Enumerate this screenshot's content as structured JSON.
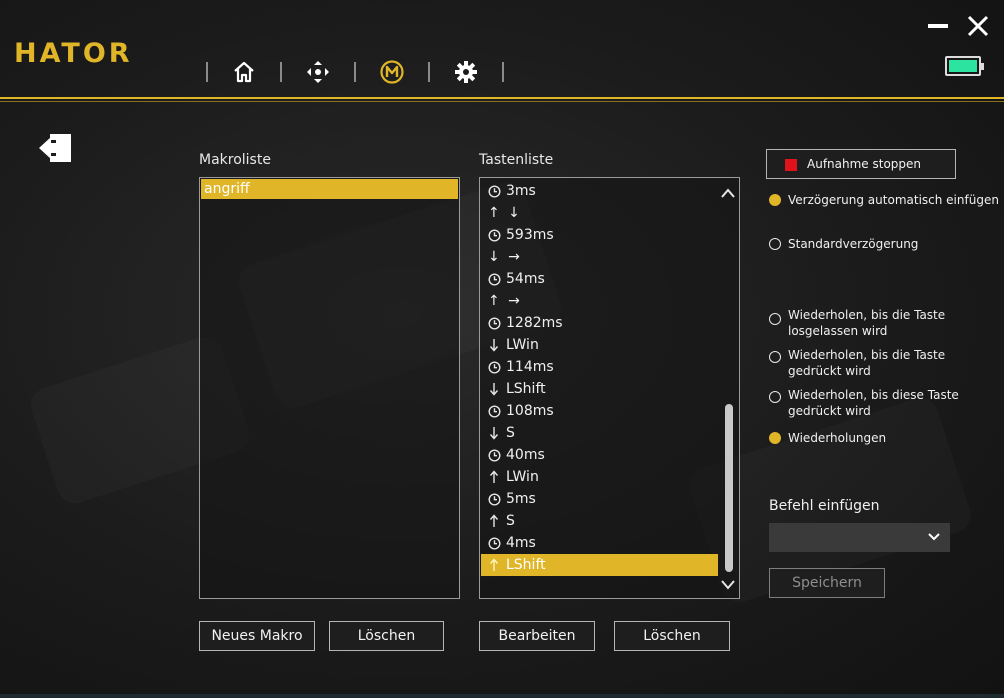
{
  "app": {
    "logo": "HATOR"
  },
  "nav": [
    {
      "name": "home-icon"
    },
    {
      "name": "dpad-icon"
    },
    {
      "name": "macro-m-icon"
    },
    {
      "name": "gear-icon"
    }
  ],
  "colors": {
    "accent": "#e0b528",
    "battery": "#2de3a0",
    "record_stop": "#e0121b"
  },
  "macro_list": {
    "label": "Makroliste",
    "items": [
      "angriff"
    ],
    "selected_index": 0,
    "new_button": "Neues Makro",
    "delete_button": "Löschen"
  },
  "key_list": {
    "label": "Tastenliste",
    "rows": [
      {
        "icon": "clock-icon",
        "text": "3ms"
      },
      {
        "icon": "arrows-icon",
        "text": "↑ ↓"
      },
      {
        "icon": "clock-icon",
        "text": "593ms"
      },
      {
        "icon": "arrows-icon",
        "text": "↓ →"
      },
      {
        "icon": "clock-icon",
        "text": "54ms"
      },
      {
        "icon": "arrows-icon",
        "text": "↑ →"
      },
      {
        "icon": "clock-icon",
        "text": "1282ms"
      },
      {
        "icon": "arrow-down-icon",
        "text": "LWin"
      },
      {
        "icon": "clock-icon",
        "text": "114ms"
      },
      {
        "icon": "arrow-down-icon",
        "text": "LShift"
      },
      {
        "icon": "clock-icon",
        "text": "108ms"
      },
      {
        "icon": "arrow-down-icon",
        "text": "S"
      },
      {
        "icon": "clock-icon",
        "text": "40ms"
      },
      {
        "icon": "arrow-up-icon",
        "text": "LWin"
      },
      {
        "icon": "clock-icon",
        "text": "5ms"
      },
      {
        "icon": "arrow-up-icon",
        "text": "S"
      },
      {
        "icon": "clock-icon",
        "text": "4ms"
      },
      {
        "icon": "arrow-up-icon",
        "text": "LShift"
      }
    ],
    "selected_index": 17,
    "edit_button": "Bearbeiten",
    "delete_button": "Löschen"
  },
  "record": {
    "stop_label": "Aufnahme stoppen"
  },
  "options": {
    "auto_delay": "Verzögerung automatisch einfügen",
    "standard_delay": "Standardverzögerung",
    "repeat_release_1": "Wiederholen, bis die Taste",
    "repeat_release_2": "losgelassen wird",
    "repeat_press_1": "Wiederholen, bis die Taste",
    "repeat_press_2": "gedrückt wird",
    "repeat_this_1": "Wiederholen, bis diese Taste",
    "repeat_this_2": "gedrückt wird",
    "repetitions": "Wiederholungen"
  },
  "command": {
    "label": "Befehl einfügen",
    "value": "",
    "save_button": "Speichern"
  }
}
